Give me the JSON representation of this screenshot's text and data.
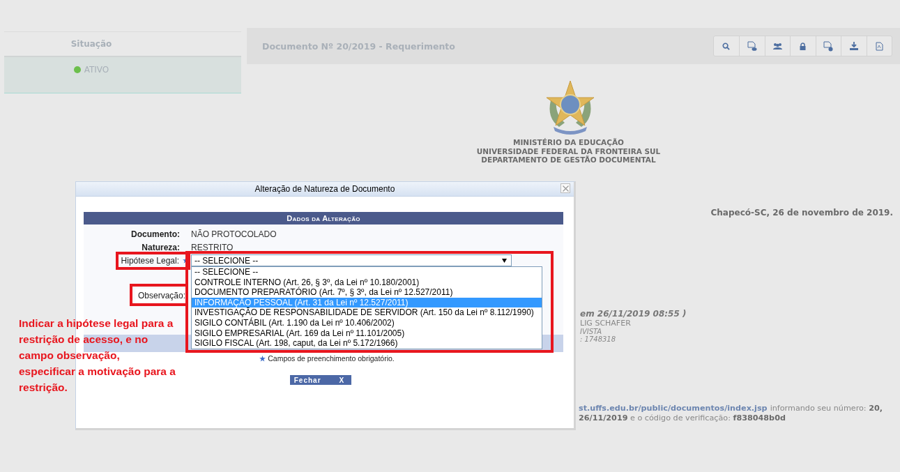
{
  "left_panel": {
    "column_header": "Situação",
    "rows": [
      {
        "status": "ATIVO",
        "color": "#6cbf4c"
      }
    ]
  },
  "document": {
    "title": "Documento Nº 20/2019 - Requerimento",
    "header_lines": [
      "MINISTÉRIO DA EDUCAÇÃO",
      "UNIVERSIDADE FEDERAL DA FRONTEIRA SUL",
      "DEPARTAMENTO DE GESTÃO DOCUMENTAL"
    ],
    "date": "Chapecó-SC, 26 de novembro de 2019.",
    "signature": {
      "signed_at": "em 26/11/2019 08:55 )",
      "name": "LIG SCHAFER",
      "role": "IVISTA",
      "registration": ": 1748318"
    },
    "footer": {
      "link": "st.uffs.edu.br/public/documentos/index.jsp",
      "line_1": "informando seu número: **20,**",
      "line_2": "**26/11/2019** e o código de verificação: **f838048b0d**"
    }
  },
  "dialog": {
    "title": "Alteração de Natureza de Documento",
    "section_title": "Dados da Alteração",
    "fields": [
      {
        "kind": "text",
        "label": "Documento:",
        "value": "NÃO PROTOCOLADO"
      },
      {
        "kind": "text",
        "label": "Natureza:",
        "value": "RESTRITO"
      },
      {
        "kind": "select",
        "label": "Hipótese Legal:",
        "required": true,
        "value": "-- SELECIONE --",
        "expanded": true,
        "options": [
          {
            "label": "-- SELECIONE --",
            "highlighted": false
          },
          {
            "label": "CONTROLE INTERNO (Art. 26, § 3º, da Lei nº 10.180/2001)",
            "highlighted": false
          },
          {
            "label": "DOCUMENTO PREPARATÓRIO (Art. 7º, § 3º, da Lei nº 12.527/2011)",
            "highlighted": false
          },
          {
            "label": "INFORMAÇÃO PESSOAL (Art. 31 da Lei nº 12.527/2011)",
            "highlighted": true
          },
          {
            "label": "INVESTIGAÇÃO DE RESPONSABILIDADE DE SERVIDOR (Art. 150 da Lei nº 8.112/1990)",
            "highlighted": false
          },
          {
            "label": "SIGILO CONTÁBIL (Art. 1.190 da Lei nº 10.406/2002)",
            "highlighted": false
          },
          {
            "label": "SIGILO EMPRESARIAL (Art. 169 da Lei nº 11.101/2005)",
            "highlighted": false
          },
          {
            "label": "SIGILO FISCAL (Art. 198, caput, da Lei nº 5.172/1966)",
            "highlighted": false
          }
        ]
      },
      {
        "kind": "textarea",
        "label": "Observação:"
      }
    ],
    "required_note": "Campos de preenchimento obrigatório.",
    "close_button": {
      "label": "Fechar",
      "icon": "X"
    }
  },
  "annotation": {
    "text": "Indicar a hipótese legal para a restrição de acesso, e no campo observação, especificar a motivação para a restrição."
  }
}
